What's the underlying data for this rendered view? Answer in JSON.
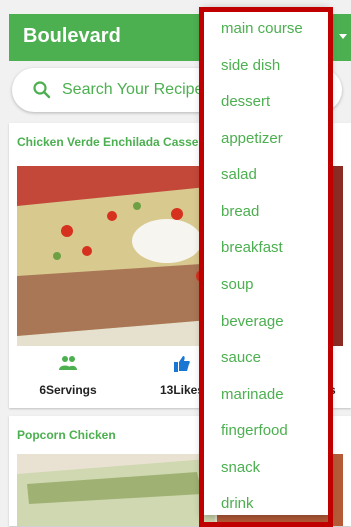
{
  "app": {
    "title": "Boulevard"
  },
  "search": {
    "placeholder": "Search Your Recipe..."
  },
  "recipes": [
    {
      "title": "Chicken Verde Enchilada Casserole",
      "servings_label": "6Servings",
      "likes_label": "13Likes",
      "third_label": "es"
    },
    {
      "title": "Popcorn Chicken"
    }
  ],
  "menu": {
    "items": [
      "main course",
      "side dish",
      "dessert",
      "appetizer",
      "salad",
      "bread",
      "breakfast",
      "soup",
      "beverage",
      "sauce",
      "marinade",
      "fingerfood",
      "snack",
      "drink"
    ]
  },
  "colors": {
    "primary": "#4caf50",
    "highlight": "#c00000",
    "background": "#f1f1f1"
  },
  "icons": {
    "search": "search-icon",
    "servings": "people-icon",
    "likes": "thumbs-up-icon",
    "dropdown": "caret-down-icon"
  }
}
